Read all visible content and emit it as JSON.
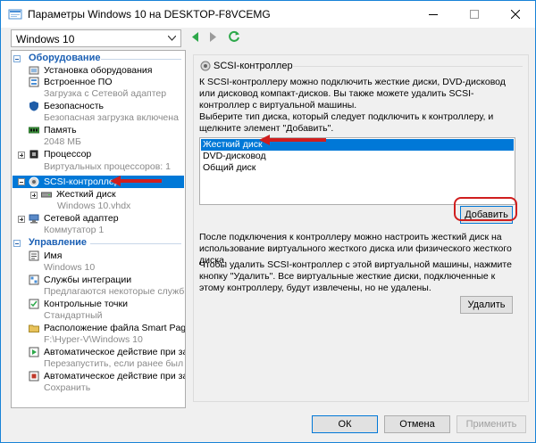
{
  "window": {
    "title": "Параметры Windows 10 на DESKTOP-F8VCEMG"
  },
  "vm_select": {
    "value": "Windows 10"
  },
  "tree": {
    "hardware_header": "Оборудование",
    "management_header": "Управление",
    "hardware": [
      {
        "label": "Установка оборудования",
        "sub": ""
      },
      {
        "label": "Встроенное ПО",
        "sub": "Загрузка с Сетевой адаптер"
      },
      {
        "label": "Безопасность",
        "sub": "Безопасная загрузка включена"
      },
      {
        "label": "Память",
        "sub": "2048 МБ"
      },
      {
        "label": "Процессор",
        "sub": "Виртуальных процессоров: 1"
      },
      {
        "label": "SCSI-контроллер",
        "sub": ""
      },
      {
        "label": "Жесткий диск",
        "sub": "Windows 10.vhdx"
      },
      {
        "label": "Сетевой адаптер",
        "sub": "Коммутатор 1"
      }
    ],
    "management": [
      {
        "label": "Имя",
        "sub": "Windows 10"
      },
      {
        "label": "Службы интеграции",
        "sub": "Предлагаются некоторые службы"
      },
      {
        "label": "Контрольные точки",
        "sub": "Стандартный"
      },
      {
        "label": "Расположение файла Smart Paging",
        "sub": "F:\\Hyper-V\\Windows 10"
      },
      {
        "label": "Автоматическое действие при за...",
        "sub": "Перезапустить, если ранее был ..."
      },
      {
        "label": "Автоматическое действие при за...",
        "sub": "Сохранить"
      }
    ]
  },
  "panel": {
    "title": "SCSI-контроллер",
    "intro": "К SCSI-контроллеру можно подключить жесткие диски, DVD-дисковод или дисковод компакт-дисков. Вы также можете удалить SCSI-контроллер с виртуальной машины.",
    "choose": "Выберите тип диска, который следует подключить к контроллеру, и щелкните элемент \"Добавить\".",
    "disk_types": [
      "Жесткий диск",
      "DVD-дисковод",
      "Общий диск"
    ],
    "add_button": "Добавить",
    "after_note": "После подключения к контроллеру можно настроить жесткий диск на использование виртуального жесткого диска или физического жесткого диска.",
    "remove_note": "Чтобы удалить SCSI-контроллер с этой виртуальной машины, нажмите кнопку \"Удалить\". Все виртуальные жесткие диски, подключенные к этому контроллеру, будут извлечены, но не удалены.",
    "remove_button": "Удалить"
  },
  "footer": {
    "ok": "ОК",
    "cancel": "Отмена",
    "apply": "Применить"
  },
  "colors": {
    "accent": "#0078d7",
    "section_header": "#1a5fb4",
    "highlight": "#d01e1e"
  }
}
